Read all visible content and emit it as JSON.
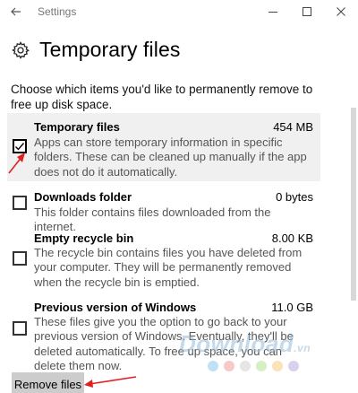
{
  "window": {
    "title": "Settings"
  },
  "page": {
    "title": "Temporary files",
    "intro": "Choose which items you'd like to permanently remove to free up disk space."
  },
  "items": [
    {
      "name": "Temporary files",
      "size": "454 MB",
      "checked": true,
      "desc": "Apps can store temporary information in specific folders. These can be cleaned up manually if the app does not do it automatically."
    },
    {
      "name": "Downloads folder",
      "size": "0 bytes",
      "checked": false,
      "desc": "This folder contains files downloaded from the internet."
    },
    {
      "name": "Empty recycle bin",
      "size": "8.00 KB",
      "checked": false,
      "desc": "The recycle bin contains files you have deleted from your computer. They will be permanently removed when the recycle bin is emptied."
    },
    {
      "name": "Previous version of Windows",
      "size": "11.0 GB",
      "checked": false,
      "desc": "These files give you the option to go back to your previous version of Windows. Eventually, they'll be deleted automatically. To free up space, you can delete them now."
    }
  ],
  "buttons": {
    "remove": "Remove files"
  },
  "watermark": {
    "text": "Download",
    "suffix": ".vn"
  },
  "colors": {
    "arrow": "#e02020",
    "button_bg": "#cccccc",
    "highlight_bg": "#f0f0f0"
  },
  "icons": [
    "back-arrow-icon",
    "minimize-icon",
    "maximize-icon",
    "close-icon",
    "gear-icon",
    "checkmark-icon",
    "annotation-arrow-icon"
  ]
}
